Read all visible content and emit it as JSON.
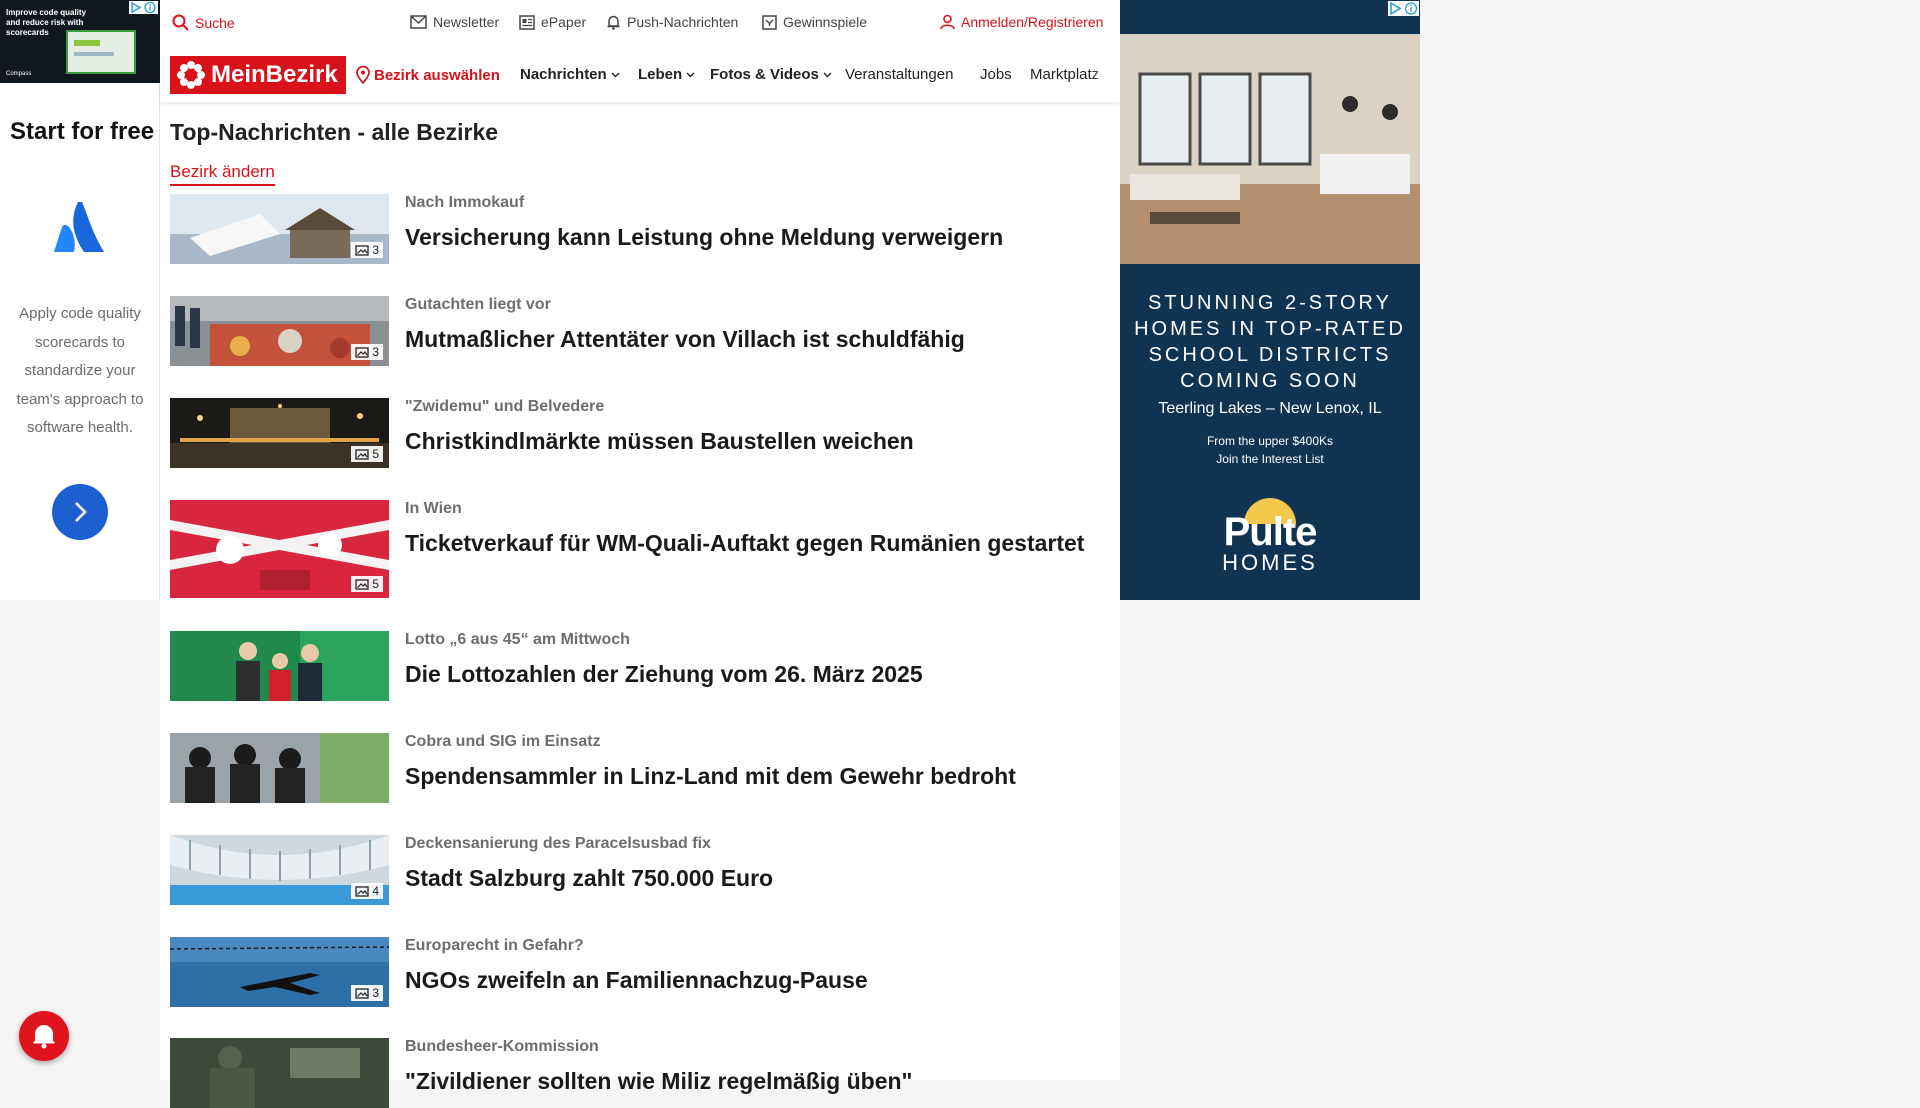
{
  "left_ad": {
    "banner_text": "Improve code quality and reduce risk with scorecards",
    "banner_logo": "Compass",
    "headline": "Start for free",
    "body": "Apply code quality scorecards to standardize your team's approach to software health.",
    "cta_icon": "chevron-right-icon"
  },
  "topbar": {
    "search_label": "Suche",
    "newsletter_label": "Newsletter",
    "epaper_label": "ePaper",
    "push_label": "Push-Nachrichten",
    "games_label": "Gewinnspiele",
    "login_label": "Anmelden/Registrieren"
  },
  "nav": {
    "brand": "MeinBezirk",
    "select_district": "Bezirk auswählen",
    "items": [
      {
        "label": "Nachrichten",
        "dropdown": true
      },
      {
        "label": "Leben",
        "dropdown": true
      },
      {
        "label": "Fotos & Videos",
        "dropdown": true
      },
      {
        "label": "Veranstaltungen",
        "dropdown": false
      },
      {
        "label": "Jobs",
        "dropdown": false
      },
      {
        "label": "Marktplatz",
        "dropdown": false
      }
    ]
  },
  "page": {
    "title": "Top-Nachrichten - alle Bezirke",
    "change_district": "Bezirk ändern"
  },
  "articles": [
    {
      "kicker": "Nach Immokauf",
      "headline": "Versicherung kann Leistung ohne Meldung verweigern",
      "images": "3"
    },
    {
      "kicker": "Gutachten liegt vor",
      "headline": "Mutmaßlicher Attentäter von Villach ist schuldfähig",
      "images": "3"
    },
    {
      "kicker": "\"Zwidemu\" und Belvedere",
      "headline": "Christkindlmärkte müssen Baustellen weichen",
      "images": "5"
    },
    {
      "kicker": "In Wien",
      "headline": "Ticketverkauf für WM-Quali-Auftakt gegen Rumänien gestartet",
      "images": "5"
    },
    {
      "kicker": "Lotto „6 aus 45“ am Mittwoch",
      "headline": "Die Lottozahlen der Ziehung vom 26. März 2025",
      "images": ""
    },
    {
      "kicker": "Cobra und SIG im Einsatz",
      "headline": "Spendensammler in Linz-Land mit dem Gewehr bedroht",
      "images": ""
    },
    {
      "kicker": "Deckensanierung des Paracelsusbad fix",
      "headline": "Stadt Salzburg zahlt 750.000 Euro",
      "images": "4"
    },
    {
      "kicker": "Europarecht in Gefahr?",
      "headline": "NGOs zweifeln an Familiennachzug-Pause",
      "images": "3"
    },
    {
      "kicker": "Bundesheer-Kommission",
      "headline": "\"Zivildiener sollten wie Miliz regelmäßig üben\"",
      "images": ""
    }
  ],
  "right_ad": {
    "headline": "STUNNING 2-STORY HOMES IN TOP-RATED SCHOOL DISTRICTS COMING SOON",
    "location": "Teerling Lakes – New Lenox, IL",
    "price": "From the upper $400Ks",
    "cta": "Join the Interest List",
    "logo_top": "Pulte",
    "logo_bottom": "HOMES"
  },
  "colors": {
    "brand_red": "#d9121a",
    "ad_navy": "#0f3350",
    "cta_blue": "#1e5fcf"
  }
}
